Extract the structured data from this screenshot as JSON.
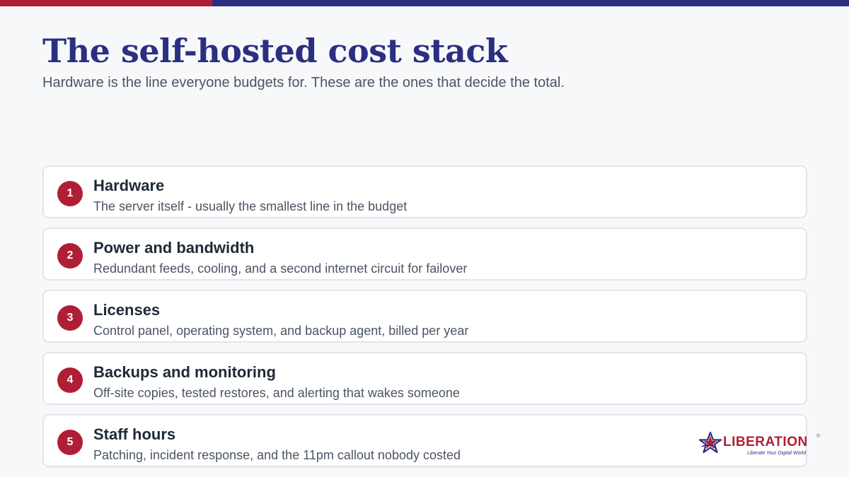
{
  "colors": {
    "accent_red": "#b01e35",
    "accent_blue": "#2b2f82",
    "title": "#2b2f82",
    "badge": "#b01e35"
  },
  "slide": {
    "title": "The self-hosted cost stack",
    "subtitle": "Hardware is the line everyone budgets for. These are the ones that decide the total."
  },
  "items": [
    {
      "number": "1",
      "title": "Hardware",
      "description": "The server itself - usually the smallest line in the budget"
    },
    {
      "number": "2",
      "title": "Power and bandwidth",
      "description": "Redundant feeds, cooling, and a second internet circuit for failover"
    },
    {
      "number": "3",
      "title": "Licenses",
      "description": "Control panel, operating system, and backup agent, billed per year"
    },
    {
      "number": "4",
      "title": "Backups and monitoring",
      "description": "Off-site copies, tested restores, and alerting that wakes someone"
    },
    {
      "number": "5",
      "title": "Staff hours",
      "description": "Patching, incident response, and the 11pm callout nobody costed"
    }
  ],
  "logo": {
    "icon": "star-logo-icon",
    "wordmark": "LIBERATION",
    "registered": "®",
    "tagline": "Liberate Your Digital World"
  }
}
